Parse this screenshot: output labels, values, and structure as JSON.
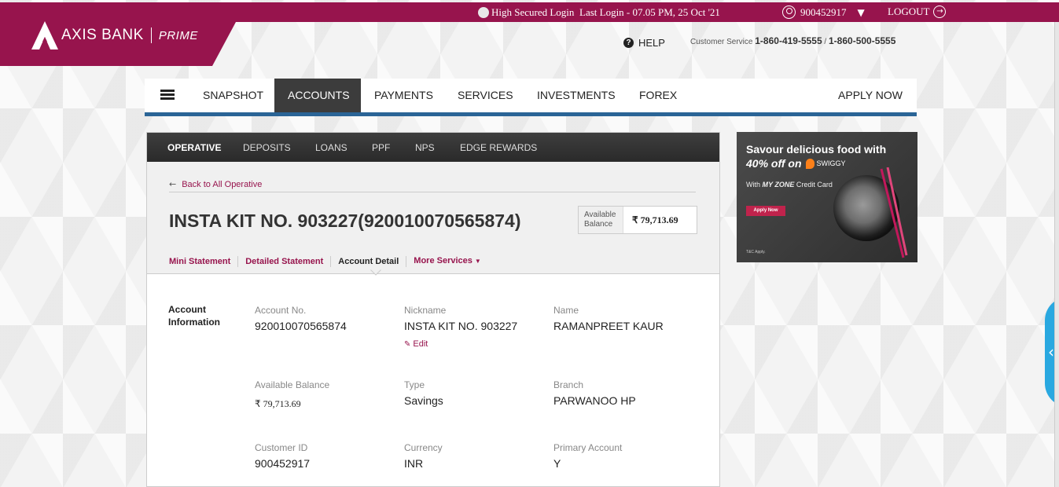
{
  "topbar": {
    "secured_label": "High Secured Login",
    "last_login": "Last Login - 07.05 PM, 25 Oct '21",
    "user_id": "900452917",
    "logout_label": "LOGOUT"
  },
  "brand": {
    "name": "AXIS BANK",
    "tier": "PRIME",
    "color": "#97144d"
  },
  "header": {
    "help_label": "HELP",
    "customer_service_label": "Customer Service",
    "phone_1": "1-860-419-5555",
    "phone_sep": " / ",
    "phone_2": "1-860-500-5555"
  },
  "mainnav": {
    "items": [
      {
        "label": "SNAPSHOT"
      },
      {
        "label": "ACCOUNTS",
        "active": true
      },
      {
        "label": "PAYMENTS"
      },
      {
        "label": "SERVICES"
      },
      {
        "label": "INVESTMENTS"
      },
      {
        "label": "FOREX"
      }
    ],
    "apply_label": "APPLY NOW"
  },
  "subnav": {
    "items": [
      {
        "label": "OPERATIVE",
        "active": true
      },
      {
        "label": "DEPOSITS"
      },
      {
        "label": "LOANS"
      },
      {
        "label": "PPF"
      },
      {
        "label": "NPS"
      },
      {
        "label": "EDGE REWARDS"
      }
    ]
  },
  "account": {
    "back_label": "Back to All Operative",
    "title": "INSTA KIT NO. 903227(920010070565874)",
    "available_label_1": "Available",
    "available_label_2": "Balance",
    "available_value": "₹ 79,713.69",
    "tabs": [
      {
        "label": "Mini Statement"
      },
      {
        "label": "Detailed Statement"
      },
      {
        "label": "Account Detail",
        "active": true
      },
      {
        "label": "More Services"
      }
    ]
  },
  "info": {
    "section_label_1": "Account",
    "section_label_2": "Information",
    "edit_label": "Edit",
    "fields": [
      {
        "label": "Account No.",
        "value": "920010070565874"
      },
      {
        "label": "Nickname",
        "value": "INSTA KIT NO. 903227"
      },
      {
        "label": "Name",
        "value": "RAMANPREET KAUR"
      },
      {
        "label": "Available Balance",
        "value": "₹ 79,713.69"
      },
      {
        "label": "Type",
        "value": "Savings"
      },
      {
        "label": "Branch",
        "value": "PARWANOO HP"
      },
      {
        "label": "Customer ID",
        "value": "900452917"
      },
      {
        "label": "Currency",
        "value": "INR"
      },
      {
        "label": "Primary Account",
        "value": "Y"
      }
    ]
  },
  "ad": {
    "line1": "Savour delicious food with",
    "line2": "40% off on",
    "partner": "SWIGGY",
    "line3_prefix": "With ",
    "line3_card": "MY ZONE",
    "line3_suffix": " Credit Card",
    "button": "Apply Now",
    "tc": "T&C Apply."
  }
}
